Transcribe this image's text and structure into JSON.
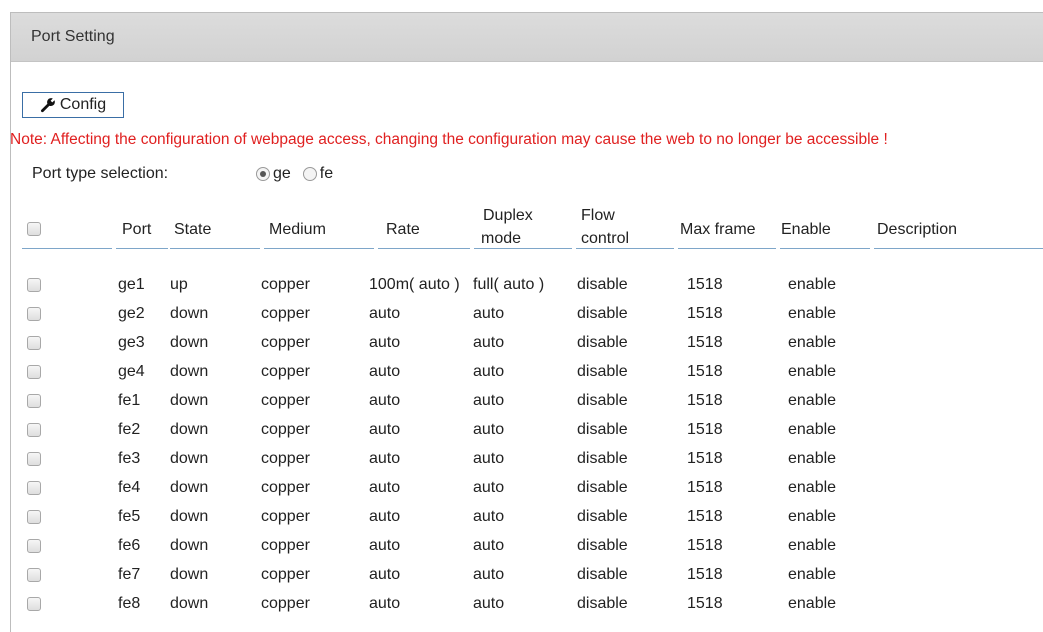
{
  "panel": {
    "title": "Port Setting"
  },
  "toolbar": {
    "config_label": "Config"
  },
  "note": "Note: Affecting the configuration of webpage access, changing the configuration may cause the web to no longer be accessible !",
  "port_type": {
    "label": "Port type selection:",
    "options": [
      {
        "label": "ge",
        "checked": true
      },
      {
        "label": "fe",
        "checked": false
      }
    ]
  },
  "table": {
    "headers": {
      "port": "Port",
      "state": "State",
      "medium": "Medium",
      "rate": "Rate",
      "duplex_1": "Duplex",
      "duplex_2": "mode",
      "flow_1": "Flow",
      "flow_2": "control",
      "max_frame": "Max frame",
      "enable": "Enable",
      "description": "Description"
    },
    "rows": [
      {
        "port": "ge1",
        "state": "up",
        "medium": "copper",
        "rate": "100m( auto )",
        "duplex": "full( auto )",
        "flow": "disable",
        "max_frame": "1518",
        "enable": "enable",
        "description": ""
      },
      {
        "port": "ge2",
        "state": "down",
        "medium": "copper",
        "rate": "auto",
        "duplex": "auto",
        "flow": "disable",
        "max_frame": "1518",
        "enable": "enable",
        "description": ""
      },
      {
        "port": "ge3",
        "state": "down",
        "medium": "copper",
        "rate": "auto",
        "duplex": "auto",
        "flow": "disable",
        "max_frame": "1518",
        "enable": "enable",
        "description": ""
      },
      {
        "port": "ge4",
        "state": "down",
        "medium": "copper",
        "rate": "auto",
        "duplex": "auto",
        "flow": "disable",
        "max_frame": "1518",
        "enable": "enable",
        "description": ""
      },
      {
        "port": "fe1",
        "state": "down",
        "medium": "copper",
        "rate": "auto",
        "duplex": "auto",
        "flow": "disable",
        "max_frame": "1518",
        "enable": "enable",
        "description": ""
      },
      {
        "port": "fe2",
        "state": "down",
        "medium": "copper",
        "rate": "auto",
        "duplex": "auto",
        "flow": "disable",
        "max_frame": "1518",
        "enable": "enable",
        "description": ""
      },
      {
        "port": "fe3",
        "state": "down",
        "medium": "copper",
        "rate": "auto",
        "duplex": "auto",
        "flow": "disable",
        "max_frame": "1518",
        "enable": "enable",
        "description": ""
      },
      {
        "port": "fe4",
        "state": "down",
        "medium": "copper",
        "rate": "auto",
        "duplex": "auto",
        "flow": "disable",
        "max_frame": "1518",
        "enable": "enable",
        "description": ""
      },
      {
        "port": "fe5",
        "state": "down",
        "medium": "copper",
        "rate": "auto",
        "duplex": "auto",
        "flow": "disable",
        "max_frame": "1518",
        "enable": "enable",
        "description": ""
      },
      {
        "port": "fe6",
        "state": "down",
        "medium": "copper",
        "rate": "auto",
        "duplex": "auto",
        "flow": "disable",
        "max_frame": "1518",
        "enable": "enable",
        "description": ""
      },
      {
        "port": "fe7",
        "state": "down",
        "medium": "copper",
        "rate": "auto",
        "duplex": "auto",
        "flow": "disable",
        "max_frame": "1518",
        "enable": "enable",
        "description": ""
      },
      {
        "port": "fe8",
        "state": "down",
        "medium": "copper",
        "rate": "auto",
        "duplex": "auto",
        "flow": "disable",
        "max_frame": "1518",
        "enable": "enable",
        "description": ""
      }
    ]
  },
  "colors": {
    "note": "#e02020",
    "header_bg": "#d6d6d6",
    "header_rule": "#7ea6c9",
    "button_border": "#3a6ea5"
  },
  "icons": {
    "config_button": "wrench-icon"
  }
}
